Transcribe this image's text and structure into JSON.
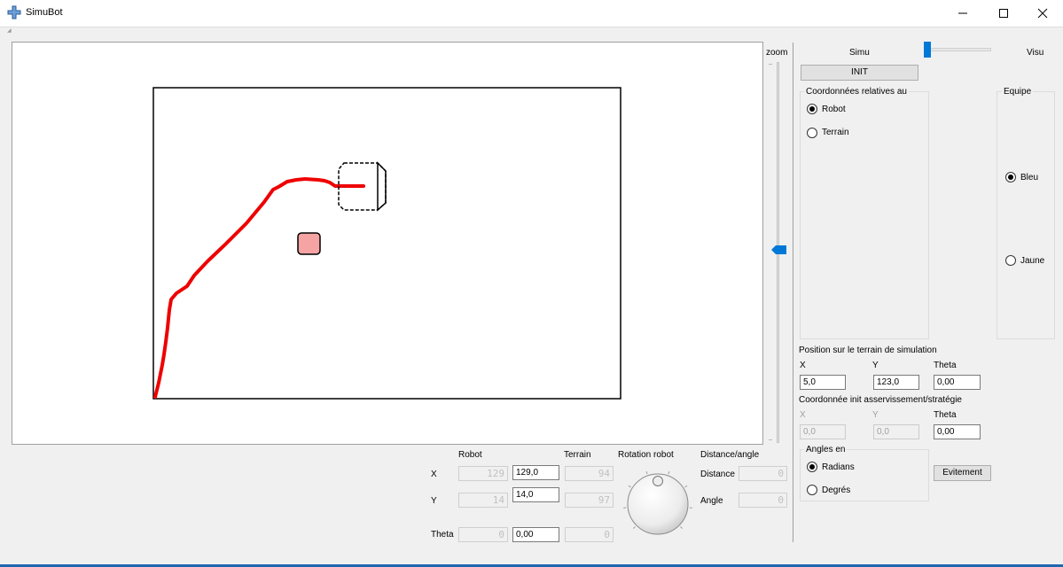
{
  "window": {
    "title": "SimuBot",
    "minimize_glyph": "minimize-icon",
    "maximize_glyph": "maximize-icon",
    "close_glyph": "close-icon",
    "accent": "#0078d7"
  },
  "canvas": {
    "path_color": "#ee0000",
    "obstacle_color": "#f5a3a3"
  },
  "zoom": {
    "label": "zoom",
    "level": 0.5
  },
  "mode": {
    "left_label": "Simu",
    "right_label": "Visu",
    "value": 0
  },
  "init_button": "INIT",
  "coords_group": {
    "title": "Coordonnées relatives au",
    "options": [
      {
        "label": "Robot",
        "checked": true
      },
      {
        "label": "Terrain",
        "checked": false
      }
    ]
  },
  "equipe_group": {
    "title": "Equipe",
    "options": [
      {
        "label": "Bleu",
        "checked": true
      },
      {
        "label": "Jaune",
        "checked": false
      }
    ]
  },
  "sim_position": {
    "title": "Position sur le terrain de simulation",
    "x_label": "X",
    "y_label": "Y",
    "theta_label": "Theta",
    "x": "5,0",
    "y": "123,0",
    "theta": "0,00"
  },
  "init_coords": {
    "title": "Coordonnée init asservissement/stratégie",
    "x_label": "X",
    "y_label": "Y",
    "theta_label": "Theta",
    "x": "0,0",
    "y": "0,0",
    "theta": "0,00"
  },
  "angles_group": {
    "title": "Angles en",
    "options": [
      {
        "label": "Radians",
        "checked": true
      },
      {
        "label": "Degrés",
        "checked": false
      }
    ]
  },
  "evitement_button": "Evitement",
  "readouts": {
    "col_robot": "Robot",
    "col_terrain": "Terrain",
    "col_rotation": "Rotation robot",
    "col_distance_angle": "Distance/angle",
    "row_x": "X",
    "row_y": "Y",
    "row_theta": "Theta",
    "robot_x_lcd": "129",
    "robot_y_lcd": "14",
    "robot_theta_lcd": "0",
    "robot_x_value": "129,0",
    "robot_y_value": "14,0",
    "robot_theta_value": "0,00",
    "terrain_x_lcd": "94",
    "terrain_y_lcd": "97",
    "terrain_theta_lcd": "0",
    "distance_label": "Distance",
    "angle_label": "Angle",
    "distance_lcd": "0",
    "angle_lcd": "0"
  }
}
